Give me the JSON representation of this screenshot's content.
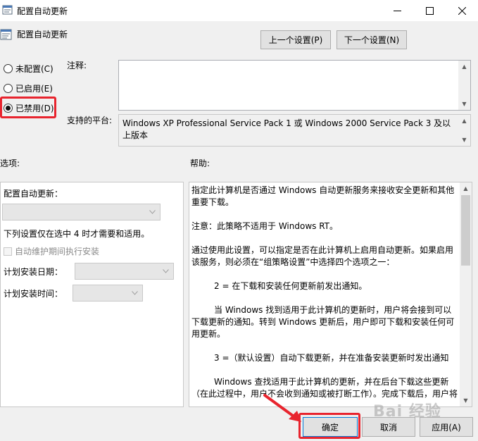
{
  "window": {
    "title": "配置自动更新",
    "minimize_glyph": "—",
    "maximize_glyph": "☐",
    "close_glyph": "✕"
  },
  "header": {
    "policy_name": "配置自动更新",
    "prev_button": "上一个设置(P)",
    "next_button": "下一个设置(N)"
  },
  "state": {
    "options": [
      {
        "label": "未配置(C)",
        "selected": false
      },
      {
        "label": "已启用(E)",
        "selected": false
      },
      {
        "label": "已禁用(D)",
        "selected": true
      }
    ]
  },
  "comment": {
    "label": "注释:",
    "value": ""
  },
  "platform": {
    "label": "支持的平台:",
    "value": "Windows XP Professional Service Pack 1 或 Windows 2000 Service Pack 3 及以上版本"
  },
  "options_panel": {
    "heading": "选项:",
    "configure_label": "配置自动更新：",
    "configure_value": "",
    "note": "下列设置仅在选中 4 时才需要和适用。",
    "maintenance_checkbox": "自动维护期间执行安装",
    "schedule_day_label": "计划安装日期：",
    "schedule_time_label": "计划安装时间："
  },
  "help_panel": {
    "heading": "帮助:",
    "paragraphs": [
      "指定此计算机是否通过 Windows 自动更新服务来接收安全更新和其他重要下载。",
      "注意：此策略不适用于 Windows RT。",
      "通过使用此设置，可以指定是否在此计算机上启用自动更新。如果启用该服务，则必须在“组策略设置”中选择四个选项之一：",
      "2 = 在下载和安装任何更新前发出通知。",
      "当 Windows 找到适用于此计算机的更新时，用户将会接到可以下载更新的通知。转到 Windows 更新后，用户即可下载和安装任何可用更新。",
      "3 =（默认设置）自动下载更新，并在准备安装更新时发出通知",
      "Windows 查找适用于此计算机的更新，并在后台下载这些更新（在此过程中，用户不会收到通知或被打断工作）。完成下载后，用户将"
    ]
  },
  "footer": {
    "ok_button": "确定",
    "cancel_button": "取消",
    "apply_button": "应用(A)"
  },
  "watermark": "Bai 经验",
  "colors": {
    "highlight_red": "#e8242e",
    "window_bg": "#f0f0f0"
  }
}
